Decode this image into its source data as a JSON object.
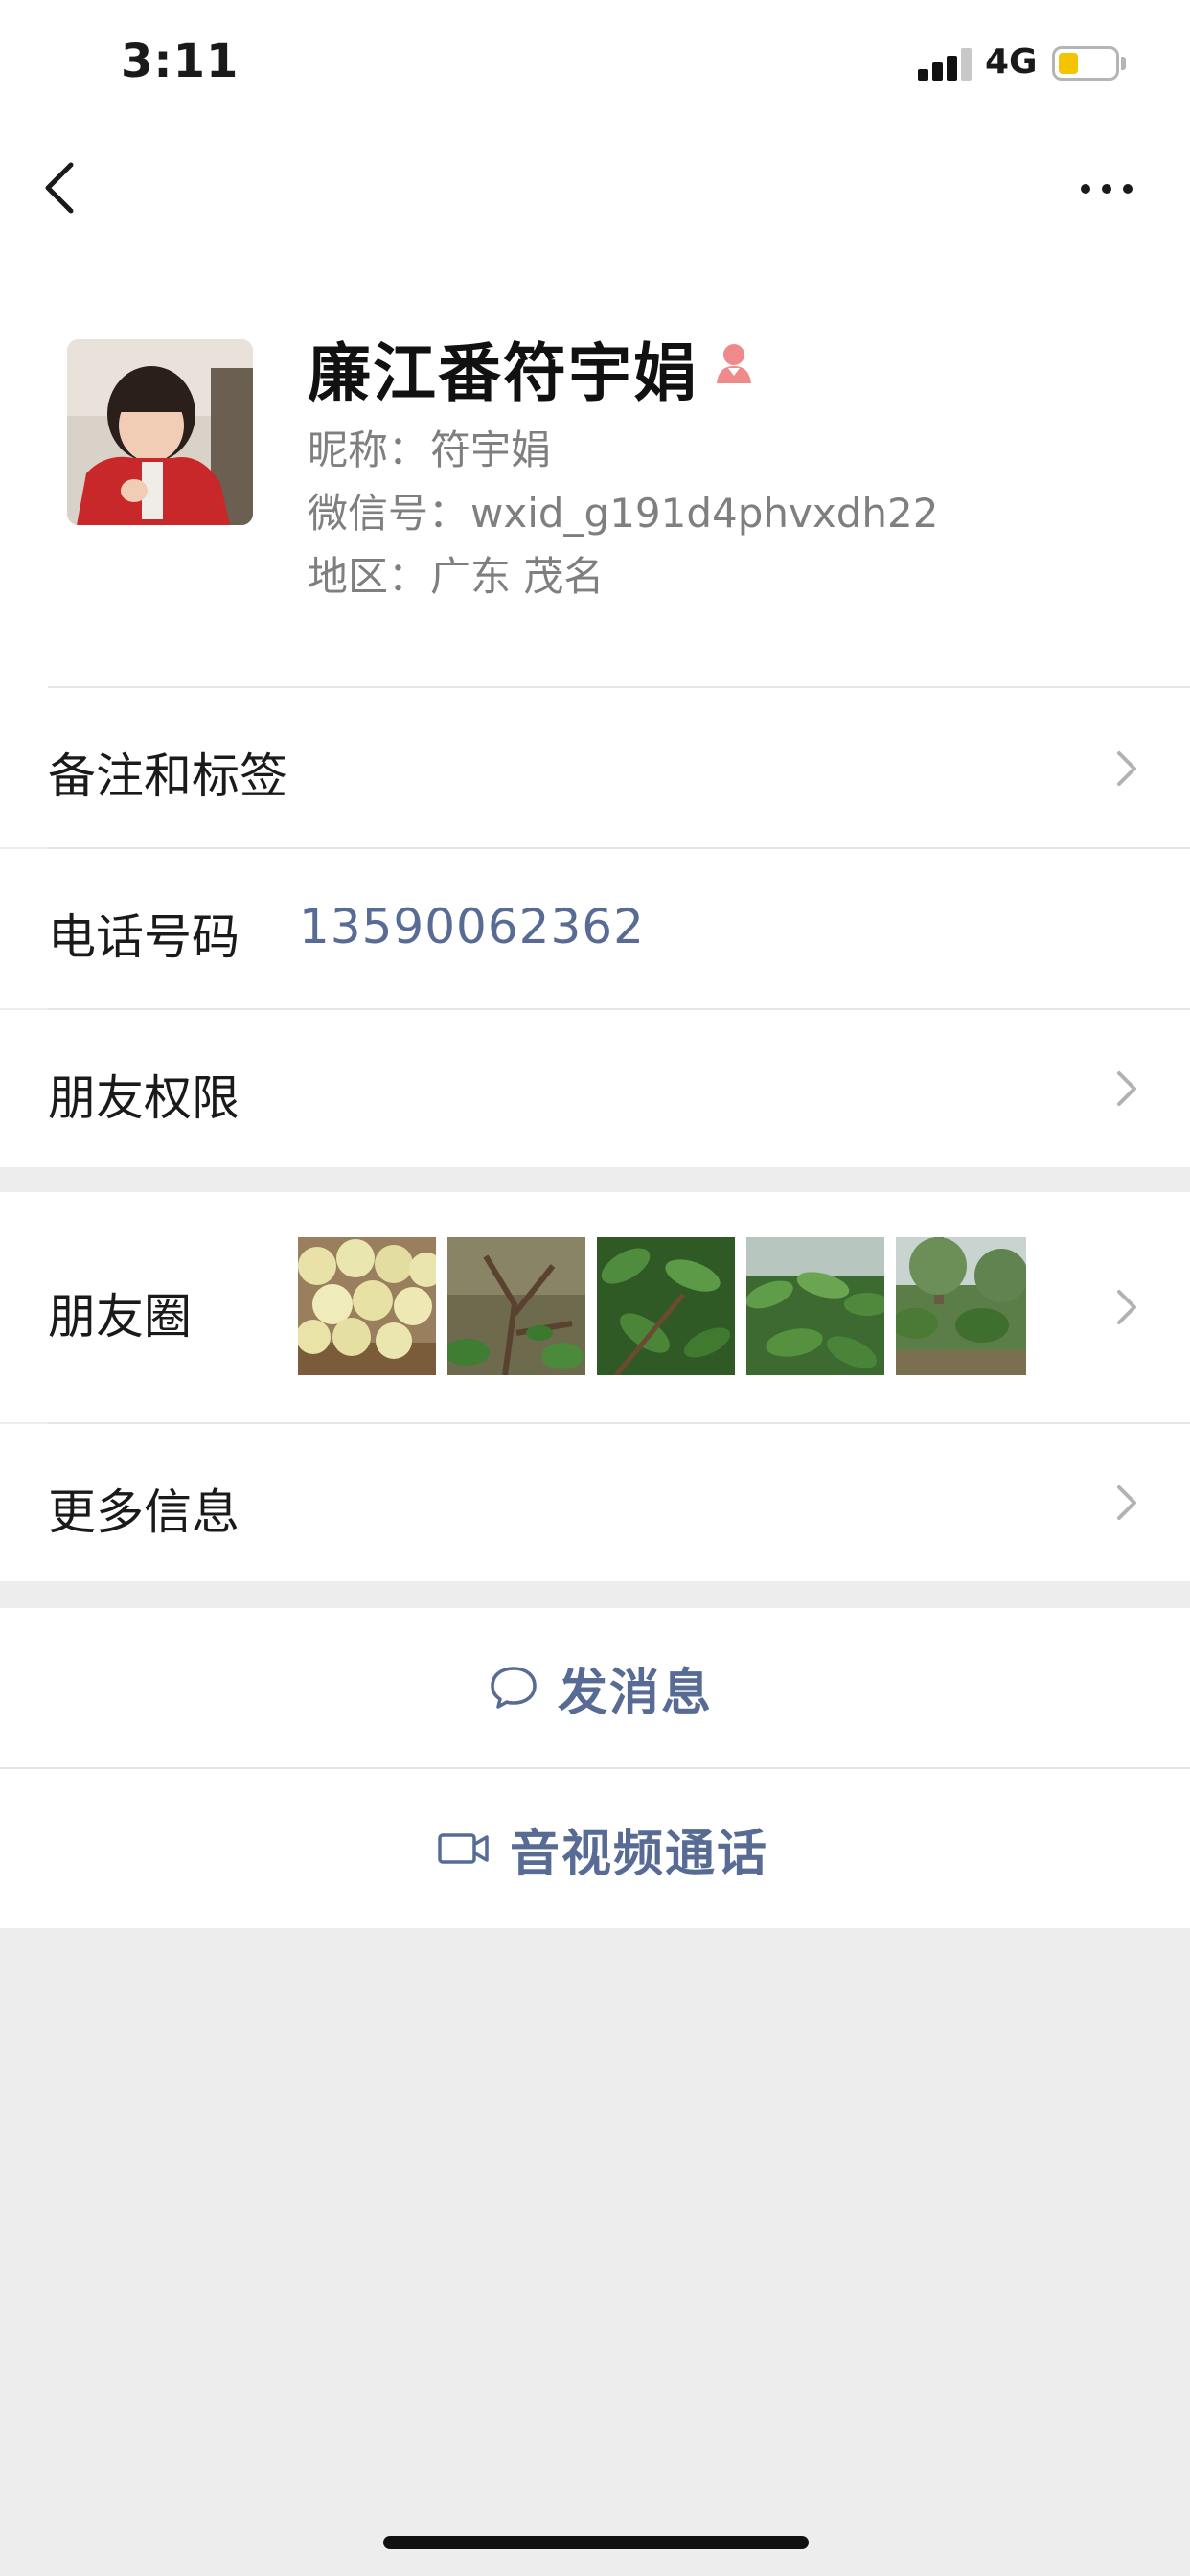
{
  "status_bar": {
    "time": "3:11",
    "network": "4G",
    "battery_level": 0.35
  },
  "nav": {
    "back_icon": "chevron-left-icon",
    "more_icon": "ellipsis-icon"
  },
  "profile": {
    "display_name": "廉江番符宇娟",
    "gender_icon": "female-icon",
    "gender_color": "#fa5151",
    "nickname_label": "昵称：",
    "nickname": "符宇娟",
    "wechat_id_label": "微信号：",
    "wechat_id": "wxid_g191d4phvxdh22",
    "region_label": "地区：",
    "region": "广东 茂名"
  },
  "rows": {
    "remarks_tags": "备注和标签",
    "phone_label": "电话号码",
    "phone_value": "13590062362",
    "friend_permissions": "朋友权限",
    "moments": "朋友圈",
    "more_info": "更多信息"
  },
  "actions": {
    "send_message": "发消息",
    "send_message_icon": "chat-bubble-icon",
    "av_call": "音视频通话",
    "av_call_icon": "video-camera-icon"
  },
  "colors": {
    "link": "#576b95",
    "background": "#ededed"
  }
}
